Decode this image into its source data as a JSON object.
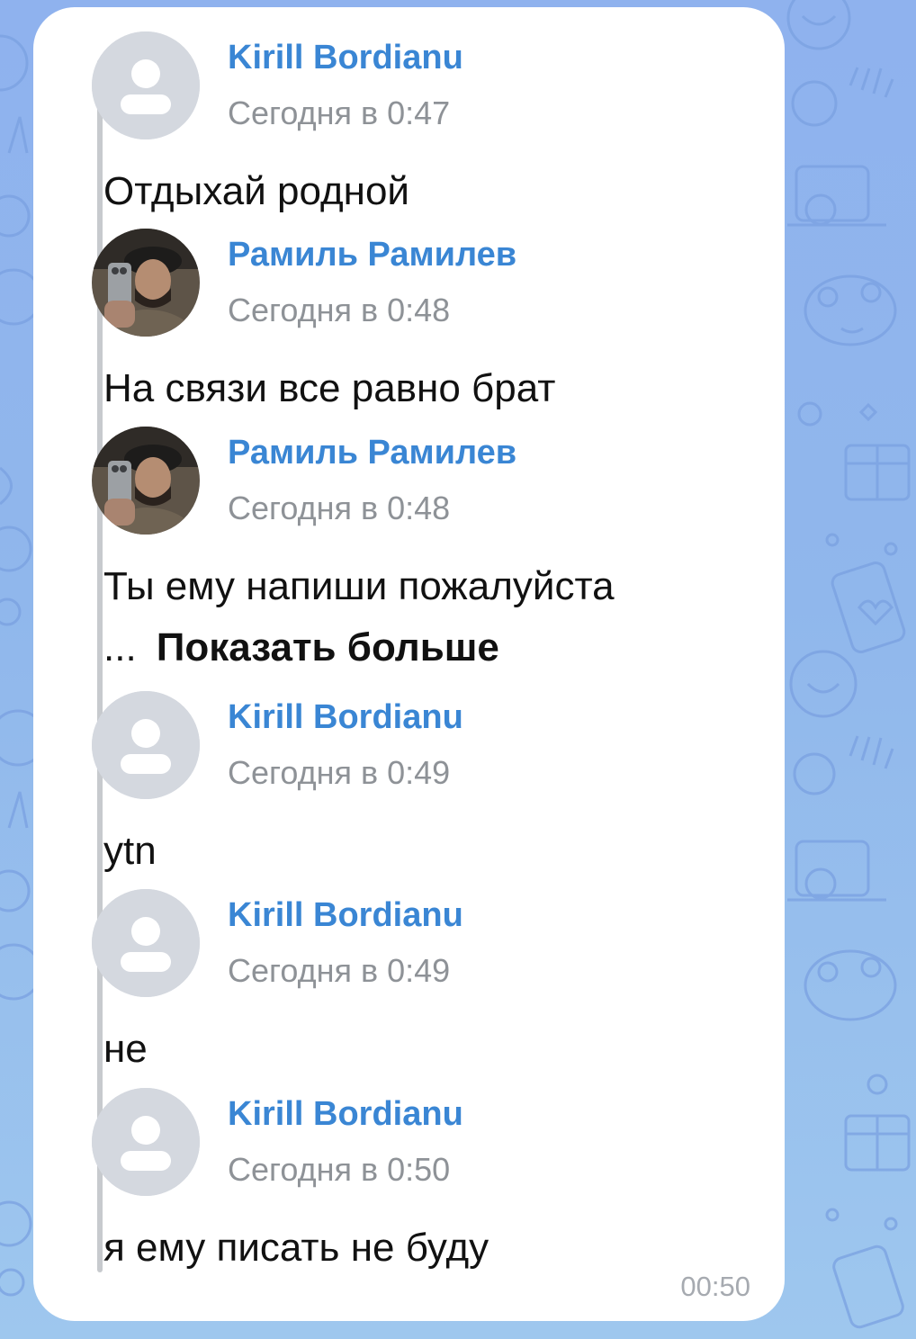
{
  "messages": [
    {
      "sender": "Kirill Bordianu",
      "time": "Сегодня в 0:47",
      "text": "Отдыхай родной",
      "avatar": "placeholder"
    },
    {
      "sender": "Рамиль Рамилев",
      "time": "Сегодня в 0:48",
      "text": "На связи все равно брат",
      "avatar": "photo"
    },
    {
      "sender": "Рамиль Рамилев",
      "time": "Сегодня в 0:48",
      "text": "Ты ему напиши пожалуйста",
      "avatar": "photo"
    },
    {
      "sender": "Kirill Bordianu",
      "time": "Сегодня в 0:49",
      "text": "ytn",
      "avatar": "placeholder"
    },
    {
      "sender": "Kirill Bordianu",
      "time": "Сегодня в 0:49",
      "text": "не",
      "avatar": "placeholder"
    },
    {
      "sender": "Kirill Bordianu",
      "time": "Сегодня в 0:50",
      "text": "я ему писать не буду",
      "avatar": "placeholder"
    }
  ],
  "show_more": {
    "ellipsis": "...",
    "label": "Показать больше"
  },
  "bubble_time": "00:50",
  "colors": {
    "sender": "#3a86d4",
    "time": "#8e9297",
    "background": "#90b7ec",
    "bubble": "#ffffff",
    "avatar_placeholder": "#d4d8df"
  }
}
